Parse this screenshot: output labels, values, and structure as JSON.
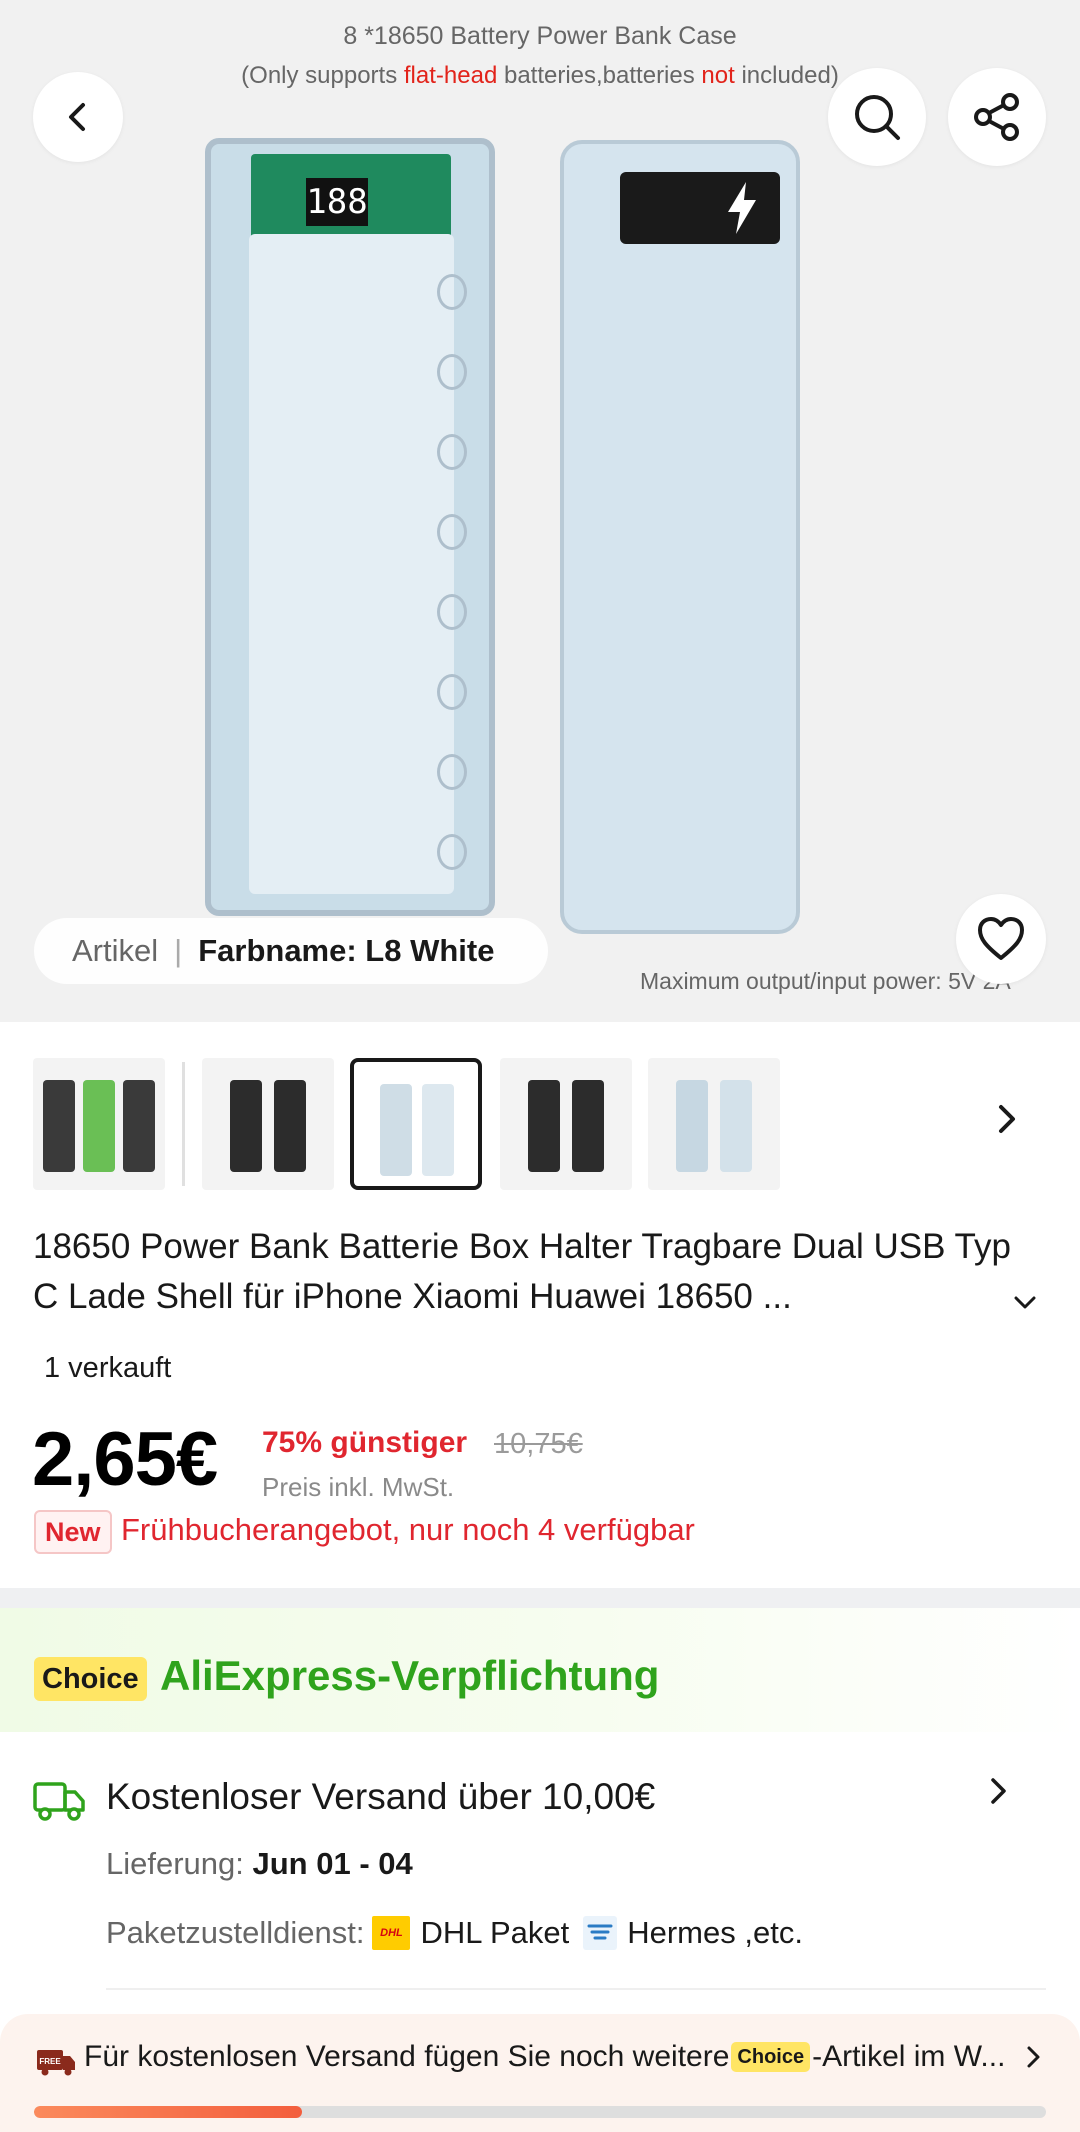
{
  "hero": {
    "caption_line1": "8 *18650 Battery Power Bank Case",
    "caption_line2_a": "(Only supports ",
    "caption_line2_red1": "flat-head",
    "caption_line2_b": " batteries,batteries ",
    "caption_line2_red2": "not",
    "caption_line2_c": " included)",
    "pcb_digits": "188",
    "pill_label": "Artikel",
    "pill_separator": "|",
    "pill_value": "Farbname: L8 White",
    "max_power_text": "Maximum output/input power:  5V 2A"
  },
  "icons": {
    "back": "chevron-left-icon",
    "search": "search-icon",
    "share": "share-icon",
    "favorite": "heart-icon",
    "thumbs_next": "chevron-right-icon",
    "expand_title": "chevron-down-icon",
    "shipping": "truck-icon"
  },
  "thumbnails": [
    {
      "name": "black-green",
      "selected": false
    },
    {
      "name": "L8 Black",
      "selected": false
    },
    {
      "name": "L8 White",
      "selected": true
    },
    {
      "name": "L10 Black",
      "selected": false
    },
    {
      "name": "L16 White",
      "selected": false
    }
  ],
  "product": {
    "title": "18650 Power Bank Batterie Box Halter Tragbare Dual USB Typ C Lade Shell für iPhone Xiaomi Huawei 18650 ...",
    "sold": "1 verkauft",
    "price": "2,65€",
    "discount": "75% günstiger",
    "original_price": "10,75€",
    "tax_note": "Preis inkl. MwSt.",
    "new_badge": "New",
    "promo": "Frühbucherangebot, nur noch 4 verfügbar"
  },
  "choice": {
    "badge": "Choice",
    "title": "AliExpress-Verpflichtung"
  },
  "shipping": {
    "title": "Kostenloser Versand über 10,00€",
    "delivery_label": "Lieferung: ",
    "delivery_value": "Jun 01 - 04",
    "carrier_label": "Paketzustelldienst: ",
    "dhl_logo_text": "DHL",
    "carrier_1": "DHL Paket",
    "carrier_2": "Hermes ,etc."
  },
  "banner": {
    "free_badge": "FREE",
    "text_before": "Für kostenlosen Versand fügen Sie noch weitere ",
    "choice_label": "Choice",
    "text_after": "-Artikel im W...",
    "progress_fraction": 0.265
  },
  "colors": {
    "accent_red": "#e0262f",
    "choice_green": "#2fa31c",
    "choice_yellow": "#ffe564",
    "progress_orange": "#f35e3d"
  }
}
